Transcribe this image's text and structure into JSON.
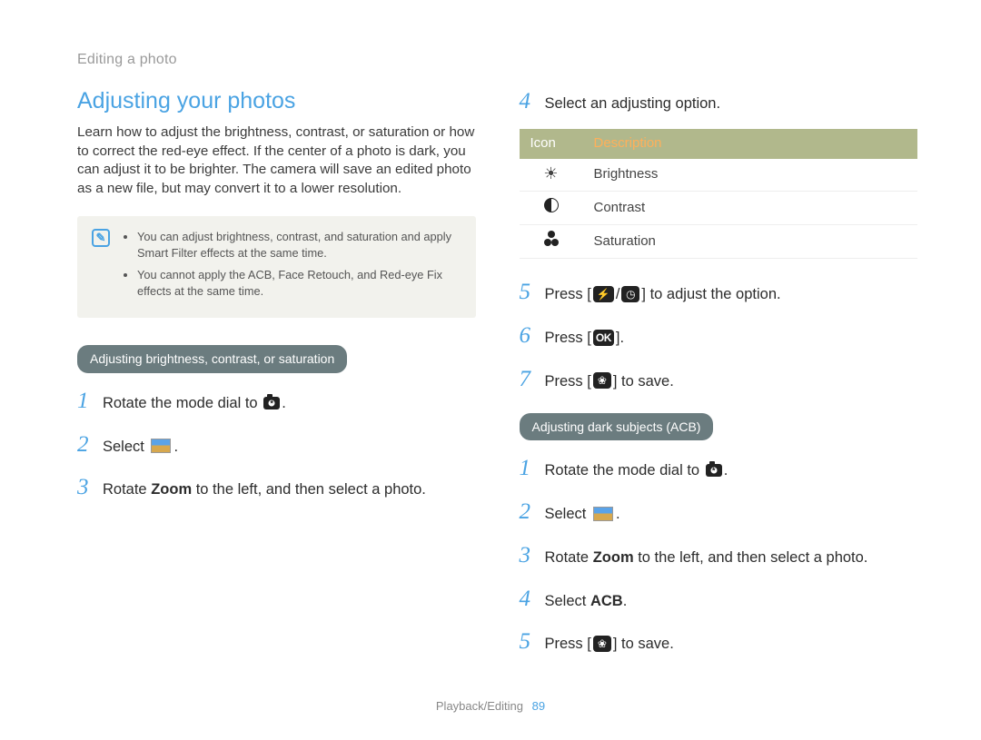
{
  "breadcrumb": "Editing a photo",
  "main": {
    "title": "Adjusting your photos",
    "intro": "Learn how to adjust the brightness, contrast, or saturation or how to correct the red-eye effect. If the center of a photo is dark, you can adjust it to be brighter. The camera will save an edited photo as a new file, but may convert it to a lower resolution.",
    "notes": [
      "You can adjust brightness, contrast, and saturation and apply Smart Filter effects at the same time.",
      "You cannot apply the ACB, Face Retouch, and Red-eye Fix effects at the same time."
    ],
    "subhead1": "Adjusting brightness, contrast, or saturation",
    "steps1": {
      "s1a": "Rotate the mode dial to ",
      "s2a": "Select ",
      "s3a": "Rotate ",
      "s3b": "Zoom",
      "s3c": " to the left, and then select a photo."
    }
  },
  "right": {
    "step4": "Select an adjusting option.",
    "table": {
      "head_icon": "Icon",
      "head_desc": "Description",
      "row1": "Brightness",
      "row2": "Contrast",
      "row3": "Saturation"
    },
    "step5a": "Press [",
    "step5b": "] to adjust the option.",
    "step6a": "Press [",
    "step6b": "].",
    "step7a": "Press [",
    "step7b": "] to save.",
    "subhead2": "Adjusting dark subjects (ACB)",
    "acb": {
      "s1a": "Rotate the mode dial to ",
      "s2a": "Select ",
      "s3a": "Rotate ",
      "s3b": "Zoom",
      "s3c": " to the left, and then select a photo.",
      "s4a": "Select ",
      "s4b": "ACB",
      "s4c": ".",
      "s5a": "Press [",
      "s5b": "] to save."
    }
  },
  "footer": {
    "section": "Playback/Editing",
    "page": "89"
  },
  "icons": {
    "ok": "OK",
    "flash_timer": "⚡/⏱",
    "macro": "🌷"
  }
}
